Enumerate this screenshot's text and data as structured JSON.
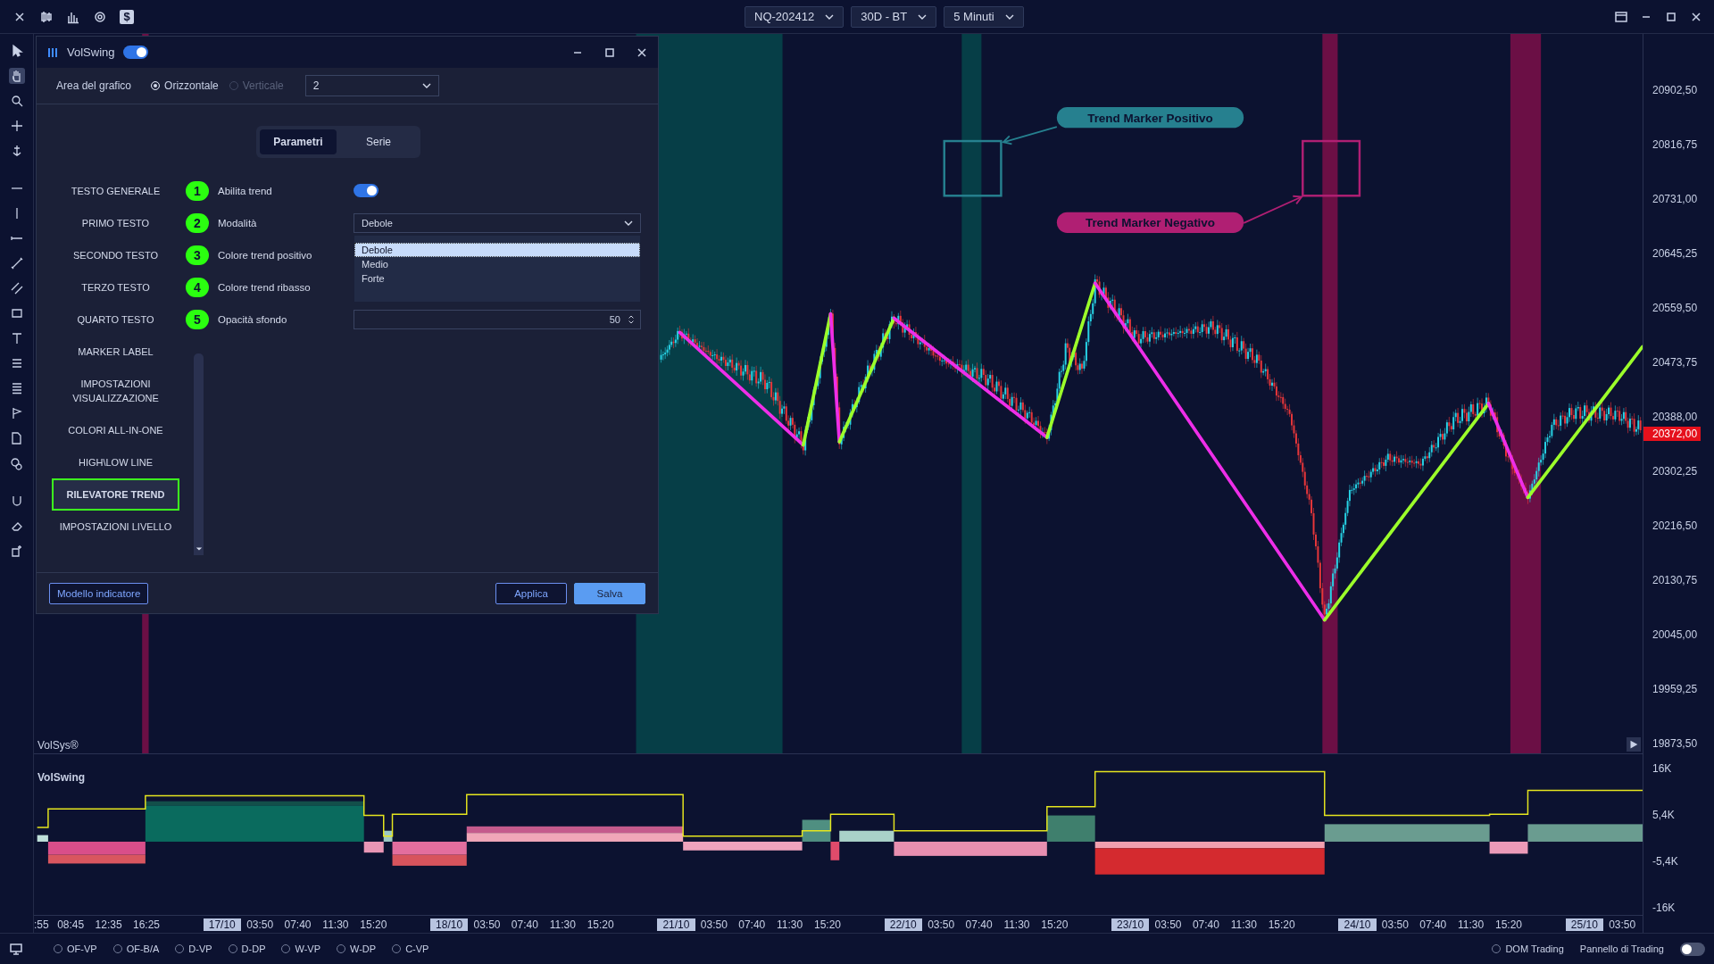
{
  "top_bar": {
    "currency_symbol": "$",
    "dropdowns": [
      {
        "label": "NQ-202412"
      },
      {
        "label": "30D - BT"
      },
      {
        "label": "5 Minuti"
      }
    ]
  },
  "chart": {
    "annotations": [
      {
        "label": "Trend Marker Positivo",
        "color": "#26808f"
      },
      {
        "label": "Trend Marker Negativo",
        "color": "#b01f73"
      }
    ],
    "watermark": "VolSys®",
    "price_axis": [
      "20902,50",
      "20816,75",
      "20731,00",
      "20645,25",
      "20559,50",
      "20473,75",
      "20388,00",
      "20302,25",
      "20216,50",
      "20130,75",
      "20045,00",
      "19959,25",
      "19873,50"
    ],
    "current_price": "20372,00"
  },
  "indicator": {
    "title": "VolSwing",
    "axis": [
      "16K",
      "5,4K",
      "-5,4K",
      "-16K"
    ]
  },
  "time_axis": [
    {
      "label": ":55",
      "kind": "time"
    },
    {
      "label": "08:45",
      "kind": "time"
    },
    {
      "label": "12:35",
      "kind": "time"
    },
    {
      "label": "16:25",
      "kind": "time"
    },
    {
      "label": "17/10",
      "kind": "date"
    },
    {
      "label": "03:50",
      "kind": "time"
    },
    {
      "label": "07:40",
      "kind": "time"
    },
    {
      "label": "11:30",
      "kind": "time"
    },
    {
      "label": "15:20",
      "kind": "time"
    },
    {
      "label": "18/10",
      "kind": "date"
    },
    {
      "label": "03:50",
      "kind": "time"
    },
    {
      "label": "07:40",
      "kind": "time"
    },
    {
      "label": "11:30",
      "kind": "time"
    },
    {
      "label": "15:20",
      "kind": "time"
    },
    {
      "label": "21/10",
      "kind": "date"
    },
    {
      "label": "03:50",
      "kind": "time"
    },
    {
      "label": "07:40",
      "kind": "time"
    },
    {
      "label": "11:30",
      "kind": "time"
    },
    {
      "label": "15:20",
      "kind": "time"
    },
    {
      "label": "22/10",
      "kind": "date"
    },
    {
      "label": "03:50",
      "kind": "time"
    },
    {
      "label": "07:40",
      "kind": "time"
    },
    {
      "label": "11:30",
      "kind": "time"
    },
    {
      "label": "15:20",
      "kind": "time"
    },
    {
      "label": "23/10",
      "kind": "date"
    },
    {
      "label": "03:50",
      "kind": "time"
    },
    {
      "label": "07:40",
      "kind": "time"
    },
    {
      "label": "11:30",
      "kind": "time"
    },
    {
      "label": "15:20",
      "kind": "time"
    },
    {
      "label": "24/10",
      "kind": "date"
    },
    {
      "label": "03:50",
      "kind": "time"
    },
    {
      "label": "07:40",
      "kind": "time"
    },
    {
      "label": "11:30",
      "kind": "time"
    },
    {
      "label": "15:20",
      "kind": "time"
    },
    {
      "label": "25/10",
      "kind": "date"
    },
    {
      "label": "03:50",
      "kind": "time"
    }
  ],
  "bottom_bar": {
    "options": [
      {
        "label": "OF-VP",
        "selected": false
      },
      {
        "label": "OF-B/A",
        "selected": false
      },
      {
        "label": "D-VP",
        "selected": false
      },
      {
        "label": "D-DP",
        "selected": false
      },
      {
        "label": "W-VP",
        "selected": false
      },
      {
        "label": "W-DP",
        "selected": false
      },
      {
        "label": "C-VP",
        "selected": false
      }
    ],
    "dom_trading": {
      "label": "DOM Trading",
      "selected": false
    },
    "trading_panel": {
      "label": "Pannello di Trading",
      "on": false
    }
  },
  "dialog": {
    "title": "VolSwing",
    "enabled": true,
    "chart_area": {
      "label": "Area del grafico",
      "options": [
        {
          "label": "Orizzontale",
          "selected": true,
          "disabled": false
        },
        {
          "label": "Verticale",
          "selected": false,
          "disabled": true
        }
      ],
      "value": "2"
    },
    "tabs": [
      {
        "label": "Parametri",
        "selected": true
      },
      {
        "label": "Serie",
        "selected": false
      }
    ],
    "nav_items": [
      {
        "label": "TESTO GENERALE",
        "selected": false
      },
      {
        "label": "PRIMO TESTO",
        "selected": false
      },
      {
        "label": "SECONDO TESTO",
        "selected": false
      },
      {
        "label": "TERZO TESTO",
        "selected": false
      },
      {
        "label": "QUARTO TESTO",
        "selected": false
      },
      {
        "label": "MARKER LABEL",
        "selected": false
      },
      {
        "label": "IMPOSTAZIONI VISUALIZZAZIONE",
        "selected": false
      },
      {
        "label": "COLORI ALL-IN-ONE",
        "selected": false
      },
      {
        "label": "HIGH\\LOW LINE",
        "selected": false
      },
      {
        "label": "RILEVATORE TREND",
        "selected": true
      },
      {
        "label": "IMPOSTAZIONI LIVELLO",
        "selected": false
      }
    ],
    "settings": [
      {
        "badge": "1",
        "label": "Abilita trend",
        "kind": "toggle",
        "on": true
      },
      {
        "badge": "2",
        "label": "Modalità",
        "kind": "select",
        "value": "Debole",
        "expanded": true,
        "options": [
          {
            "label": "Debole",
            "selected": true
          },
          {
            "label": "Medio",
            "selected": false
          },
          {
            "label": "Forte",
            "selected": false
          }
        ]
      },
      {
        "badge": "3",
        "label": "Colore trend positivo",
        "kind": "color"
      },
      {
        "badge": "4",
        "label": "Colore trend ribasso",
        "kind": "color"
      },
      {
        "badge": "5",
        "label": "Opacità sfondo",
        "kind": "number",
        "value": "50"
      }
    ],
    "buttons": [
      {
        "label": "Modello indicatore",
        "kind": "outline"
      },
      {
        "label": "Applica",
        "kind": "outline"
      },
      {
        "label": "Salva",
        "kind": "primary"
      }
    ]
  }
}
